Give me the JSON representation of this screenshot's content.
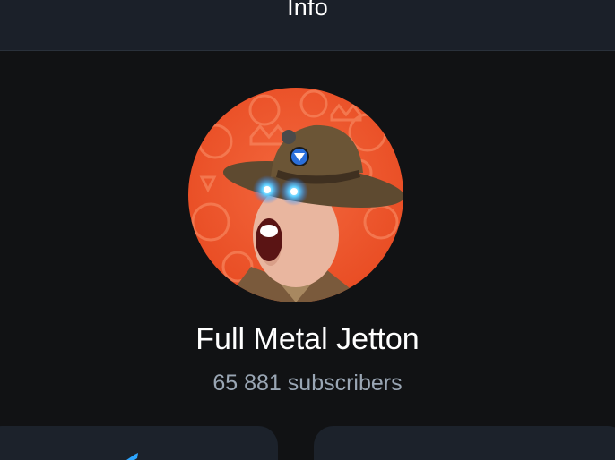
{
  "header": {
    "title": "Info"
  },
  "channel": {
    "name": "Full Metal Jetton",
    "subscribers": "65 881 subscribers",
    "avatar_icon": "drill-sergeant-avatar"
  },
  "actions": [
    {
      "icon": "send-icon"
    },
    {
      "icon": ""
    }
  ],
  "colors": {
    "background": "#111214",
    "header": "#1b2029",
    "card": "#1c222b",
    "subtitle": "#9aa6b4",
    "accent": "#2ea6ff"
  }
}
